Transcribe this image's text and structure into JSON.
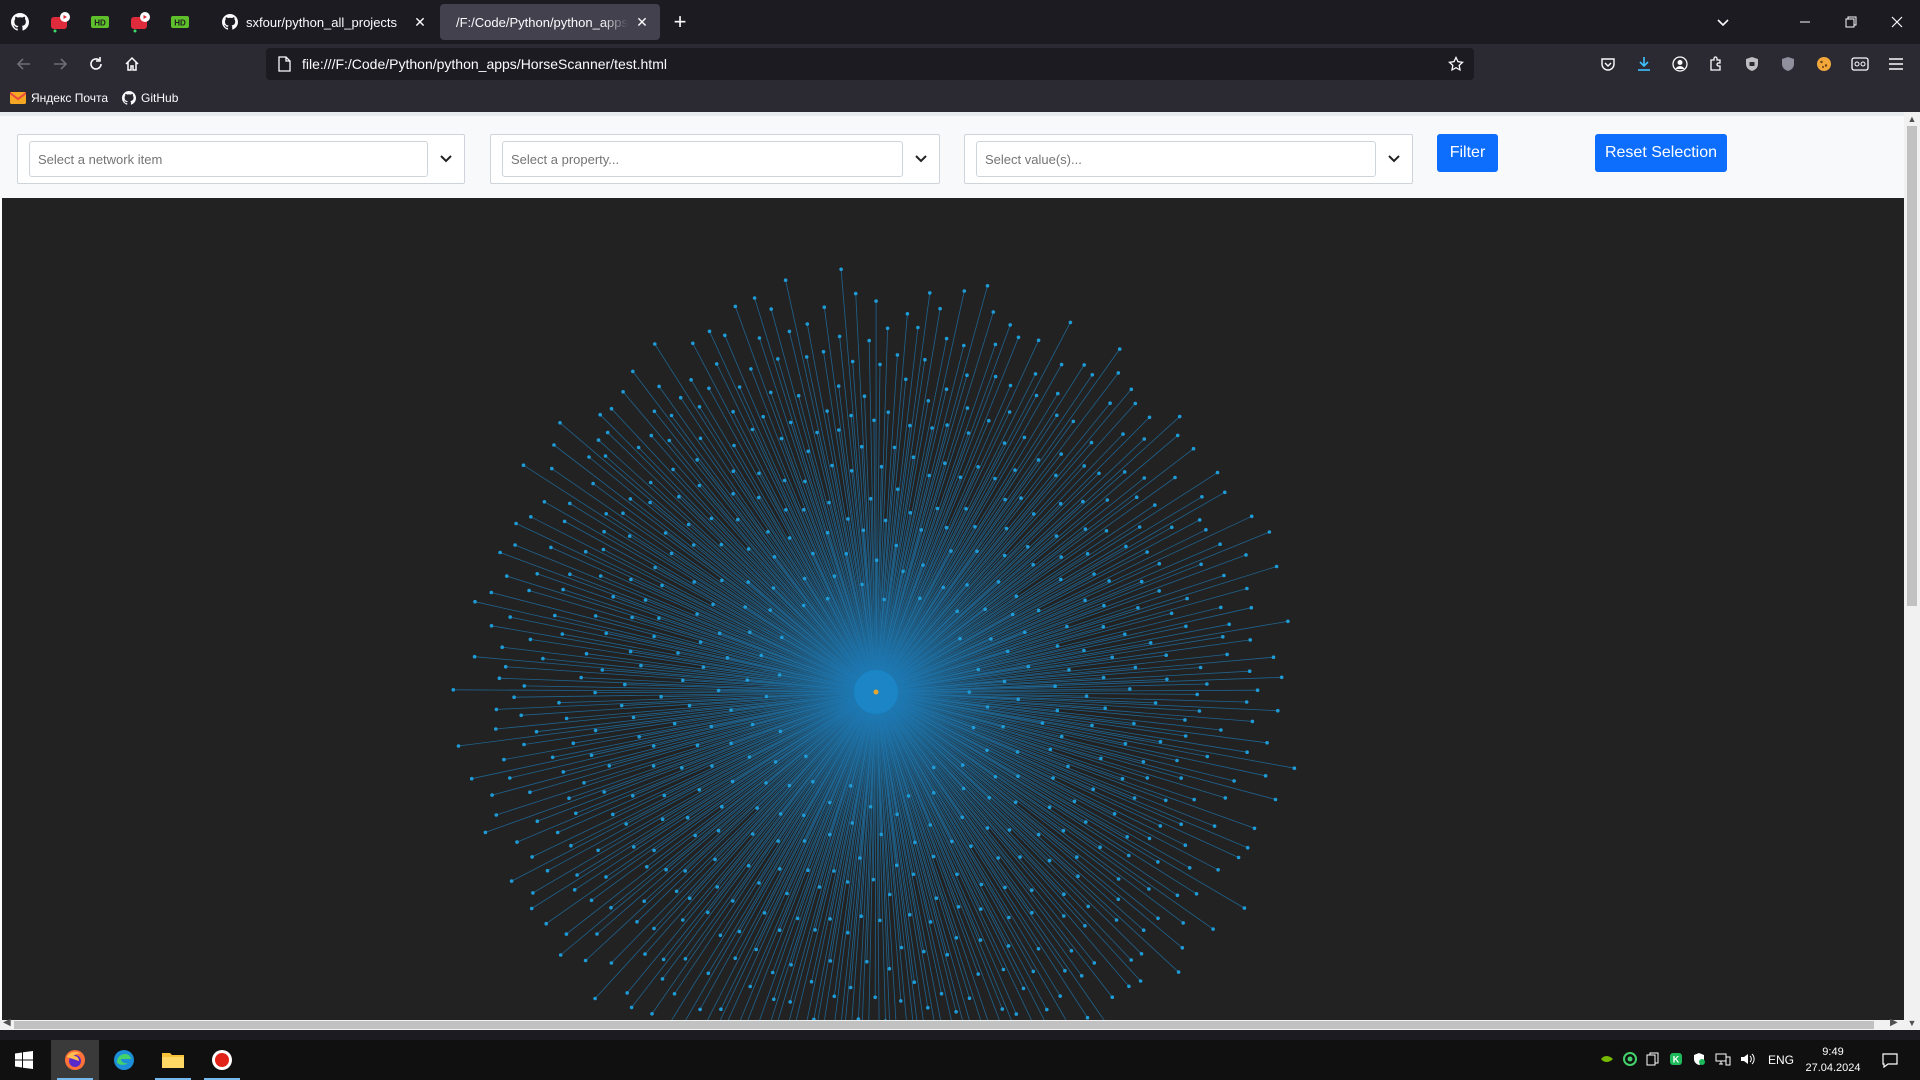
{
  "browser": {
    "tabs": [
      {
        "title": "sxfour/python_all_projects",
        "close": "✕"
      },
      {
        "title": "/F:/Code/Python/python_apps/HorseScanner/test.html",
        "close": "✕"
      }
    ],
    "new_tab": "+",
    "url": "file:///F:/Code/Python/python_apps/HorseScanner/test.html",
    "bookmarks": [
      {
        "label": "Яндекс Почта",
        "icon": "mail-icon"
      },
      {
        "label": "GitHub",
        "icon": "github-icon"
      }
    ]
  },
  "filters": {
    "network_item_placeholder": "Select a network item",
    "property_placeholder": "Select a property...",
    "values_placeholder": "Select value(s)...",
    "filter_button": "Filter",
    "reset_button": "Reset Selection"
  },
  "network": {
    "layout": "radial star",
    "edge_color": "#1f7ab3",
    "node_color": "#1e9cd8",
    "center_node_color": "#e8a52d",
    "background": "#222222"
  },
  "taskbar": {
    "language": "ENG",
    "time": "9:49",
    "date": "27.04.2024"
  }
}
